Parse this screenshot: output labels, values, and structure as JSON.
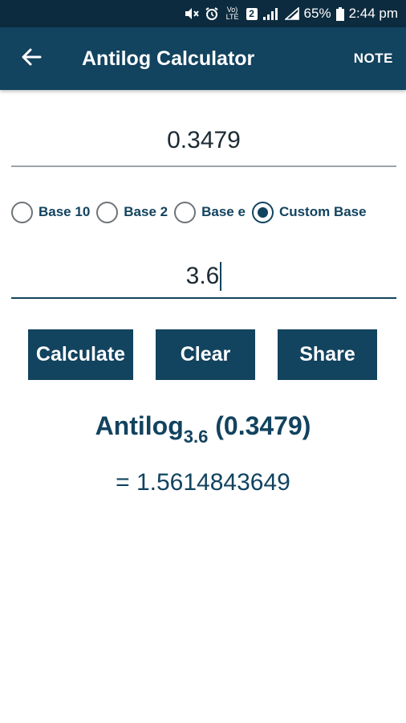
{
  "status_bar": {
    "battery": "65%",
    "time": "2:44 pm",
    "sim_slot": "2",
    "network": "Vo) LTE"
  },
  "app_bar": {
    "title": "Antilog Calculator",
    "note_label": "NOTE",
    "back_icon": "arrow-left-icon"
  },
  "input": {
    "value": "0.3479"
  },
  "base_options": [
    {
      "label": "Base 10",
      "checked": false
    },
    {
      "label": "Base 2",
      "checked": false
    },
    {
      "label": "Base e",
      "checked": false
    },
    {
      "label": "Custom Base",
      "checked": true
    }
  ],
  "custom_base": {
    "value": "3.6"
  },
  "buttons": {
    "calculate": "Calculate",
    "clear": "Clear",
    "share": "Share"
  },
  "result": {
    "prefix": "Antilog",
    "base": "3.6",
    "argument": "(0.3479)",
    "value": "= 1.5614843649"
  },
  "colors": {
    "primary": "#12435f",
    "status_bar": "#0d2b3e"
  }
}
